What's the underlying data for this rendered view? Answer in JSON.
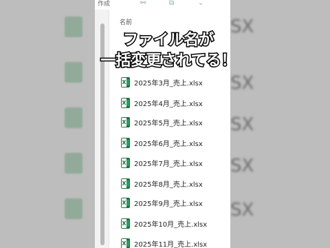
{
  "top": {
    "label": "作成",
    "chevron": "chevron-down-icon"
  },
  "column_header": "名前",
  "caption": {
    "line1": "ファイル名が",
    "line2": "一括変更されてる！"
  },
  "files": [
    "2025年3月_売上.xlsx",
    "2025年4月_売上.xlsx",
    "2025年5月_売上.xlsx",
    "2025年6月_売上.xlsx",
    "2025年7月_売上.xlsx",
    "2025年8月_売上.xlsx",
    "2025年9月_売上.xlsx",
    "2025年10月_売上.xlsx",
    "2025年11月_売上.xlsx"
  ],
  "background_text": [
    "SX",
    "SX",
    "SX",
    "SX",
    "SX",
    "SX"
  ],
  "colors": {
    "excel_green": "#1f7244",
    "bg_gray": "#bdbdbd"
  }
}
